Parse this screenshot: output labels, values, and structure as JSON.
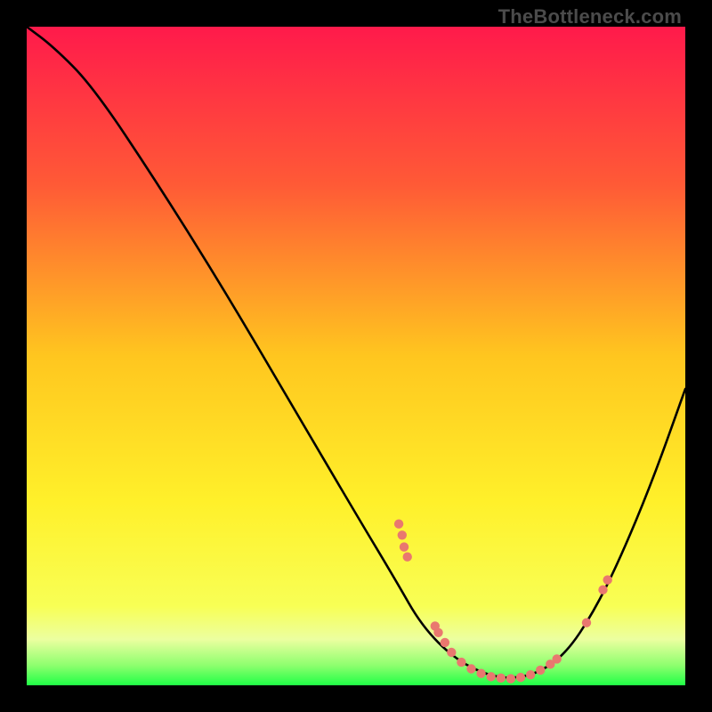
{
  "watermark": "TheBottleneck.com",
  "colors": {
    "background": "#000000",
    "gradient_top": "#ff1a4b",
    "gradient_mid_upper": "#ff6a2f",
    "gradient_mid": "#ffd21f",
    "gradient_lower": "#fff833",
    "gradient_band": "#f8ff60",
    "gradient_bottom": "#27ff4a",
    "curve": "#000000",
    "dot": "#e9786f",
    "watermark": "#4b4b4b"
  },
  "chart_data": {
    "type": "line",
    "title": "",
    "xlabel": "",
    "ylabel": "",
    "xlim": [
      0,
      100
    ],
    "ylim": [
      0,
      100
    ],
    "curve": [
      {
        "x": 0,
        "y": 100
      },
      {
        "x": 4,
        "y": 97
      },
      {
        "x": 10,
        "y": 91
      },
      {
        "x": 20,
        "y": 76
      },
      {
        "x": 30,
        "y": 60
      },
      {
        "x": 40,
        "y": 43
      },
      {
        "x": 50,
        "y": 26
      },
      {
        "x": 56,
        "y": 16
      },
      {
        "x": 60,
        "y": 9
      },
      {
        "x": 65,
        "y": 4
      },
      {
        "x": 70,
        "y": 1.5
      },
      {
        "x": 74,
        "y": 1
      },
      {
        "x": 78,
        "y": 2
      },
      {
        "x": 82,
        "y": 5
      },
      {
        "x": 86,
        "y": 11
      },
      {
        "x": 90,
        "y": 19
      },
      {
        "x": 95,
        "y": 31
      },
      {
        "x": 100,
        "y": 45
      }
    ],
    "dots": [
      {
        "x": 56.5,
        "y": 24.5
      },
      {
        "x": 57.0,
        "y": 22.8
      },
      {
        "x": 57.3,
        "y": 21.0
      },
      {
        "x": 57.8,
        "y": 19.5
      },
      {
        "x": 62.0,
        "y": 9.0
      },
      {
        "x": 62.5,
        "y": 8.0
      },
      {
        "x": 63.5,
        "y": 6.5
      },
      {
        "x": 64.5,
        "y": 5.0
      },
      {
        "x": 66.0,
        "y": 3.5
      },
      {
        "x": 67.5,
        "y": 2.5
      },
      {
        "x": 69.0,
        "y": 1.8
      },
      {
        "x": 70.5,
        "y": 1.3
      },
      {
        "x": 72.0,
        "y": 1.1
      },
      {
        "x": 73.5,
        "y": 1.0
      },
      {
        "x": 75.0,
        "y": 1.2
      },
      {
        "x": 76.5,
        "y": 1.6
      },
      {
        "x": 78.0,
        "y": 2.3
      },
      {
        "x": 79.5,
        "y": 3.2
      },
      {
        "x": 80.5,
        "y": 4.0
      },
      {
        "x": 85.0,
        "y": 9.5
      },
      {
        "x": 87.5,
        "y": 14.5
      },
      {
        "x": 88.2,
        "y": 16.0
      }
    ]
  }
}
